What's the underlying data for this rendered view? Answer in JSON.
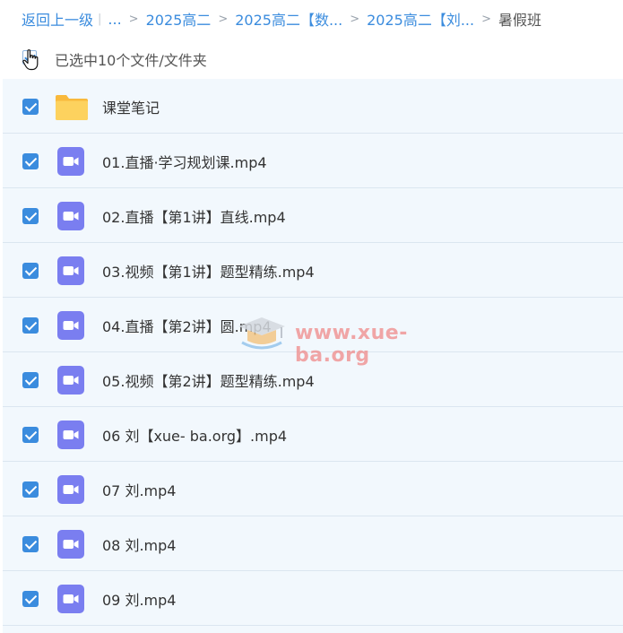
{
  "breadcrumb": {
    "back": "返回上一级",
    "ellipsis": "...",
    "items": [
      "2025高二",
      "2025高二【数...",
      "2025高二【刘...",
      "暑假班"
    ]
  },
  "selection": {
    "text": "已选中10个文件/文件夹"
  },
  "files": [
    {
      "name": "课堂笔记",
      "type": "folder"
    },
    {
      "name": "01.直播·学习规划课.mp4",
      "type": "video"
    },
    {
      "name": "02.直播【第1讲】直线.mp4",
      "type": "video"
    },
    {
      "name": "03.视频【第1讲】题型精练.mp4",
      "type": "video"
    },
    {
      "name": "04.直播【第2讲】圆.mp4",
      "type": "video"
    },
    {
      "name": "05.视频【第2讲】题型精练.mp4",
      "type": "video"
    },
    {
      "name": "06 刘【xue- ba.org】.mp4",
      "type": "video"
    },
    {
      "name": "07 刘.mp4",
      "type": "video"
    },
    {
      "name": "08 刘.mp4",
      "type": "video"
    },
    {
      "name": "09 刘.mp4",
      "type": "video"
    }
  ],
  "watermark": {
    "text": "www.xue-ba.org"
  },
  "colors": {
    "accent": "#3b8cde",
    "list_bg": "#f2f8fd",
    "folder": "#fcc84a",
    "video": "#7a7ef0",
    "watermark": "#f08a8a"
  }
}
